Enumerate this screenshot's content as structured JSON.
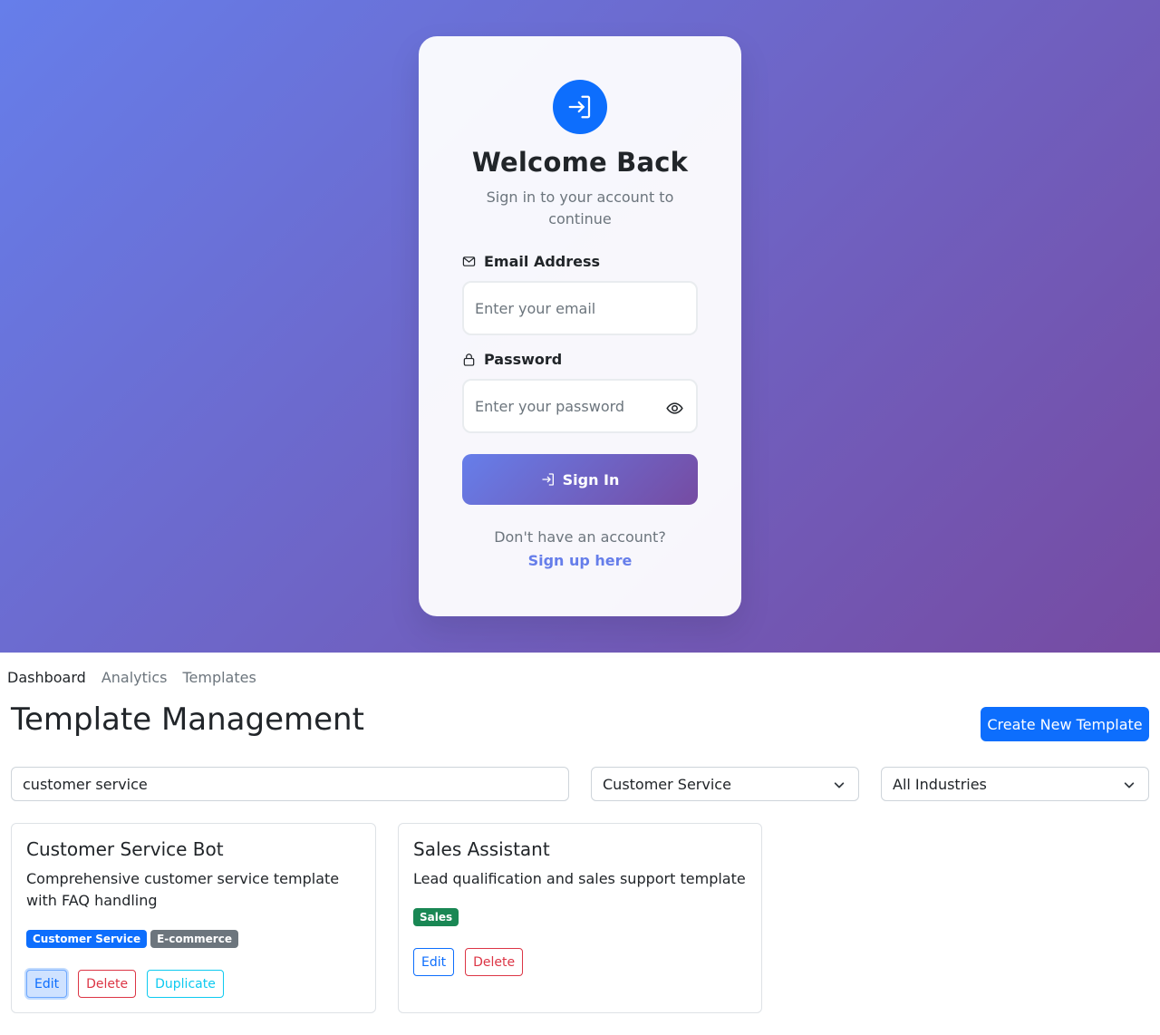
{
  "login": {
    "title": "Welcome Back",
    "subtitle": "Sign in to your account to continue",
    "email_label": "Email Address",
    "email_placeholder": "Enter your email",
    "password_label": "Password",
    "password_placeholder": "Enter your password",
    "signin_label": "Sign In",
    "no_account_text": "Don't have an account?",
    "signup_link": "Sign up here",
    "icons": {
      "logo": "sign-in-icon",
      "email": "envelope-icon",
      "password": "lock-icon",
      "toggle": "eye-icon",
      "button": "sign-in-icon"
    },
    "colors": {
      "gradient_start": "#667eea",
      "gradient_end": "#764ba2",
      "logo_bg": "#0d6efd",
      "link": "#667eea"
    }
  },
  "nav": {
    "items": [
      {
        "label": "Dashboard",
        "active": true
      },
      {
        "label": "Analytics",
        "active": false
      },
      {
        "label": "Templates",
        "active": false
      }
    ]
  },
  "main": {
    "title": "Template Management",
    "create_button": "Create New Template",
    "search_value": "customer service",
    "category_selected": "Customer Service",
    "industry_selected": "All Industries",
    "templates": [
      {
        "title": "Customer Service Bot",
        "description": "Comprehensive customer service template with FAQ handling",
        "badges": [
          {
            "label": "Customer Service",
            "color": "#0d6efd"
          },
          {
            "label": "E-commerce",
            "color": "#6c757d"
          }
        ],
        "actions": [
          "Edit",
          "Delete",
          "Duplicate"
        ]
      },
      {
        "title": "Sales Assistant",
        "description": "Lead qualification and sales support template",
        "badges": [
          {
            "label": "Sales",
            "color": "#198754"
          }
        ],
        "actions": [
          "Edit",
          "Delete"
        ]
      }
    ]
  }
}
